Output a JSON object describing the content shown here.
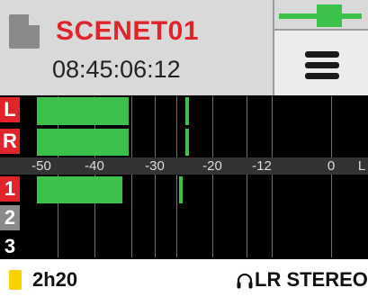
{
  "header": {
    "scene_name": "SCENET01",
    "timecode": "08:45:06:12",
    "menu_icon": "hamburger-menu-icon",
    "file_icon": "document-icon"
  },
  "meters": {
    "scale_labels": [
      "-50",
      "-40",
      "-30",
      "-20",
      "-12",
      "0",
      "L"
    ],
    "channels": [
      {
        "label": "L",
        "label_bg": "#e0242c"
      },
      {
        "label": "R",
        "label_bg": "#e0242c"
      },
      {
        "label": "1",
        "label_bg": "#e0242c"
      },
      {
        "label": "2",
        "label_bg": "#8a8a8a"
      },
      {
        "label": "3",
        "label_bg": "#000000"
      }
    ]
  },
  "footer": {
    "media_remaining": "2h20",
    "monitor_mode": "LR STEREO",
    "headphone_icon": "headphones-icon"
  },
  "colors": {
    "accent_red": "#e0242c",
    "meter_green": "#3cc24a",
    "card_yellow": "#f5d200"
  }
}
